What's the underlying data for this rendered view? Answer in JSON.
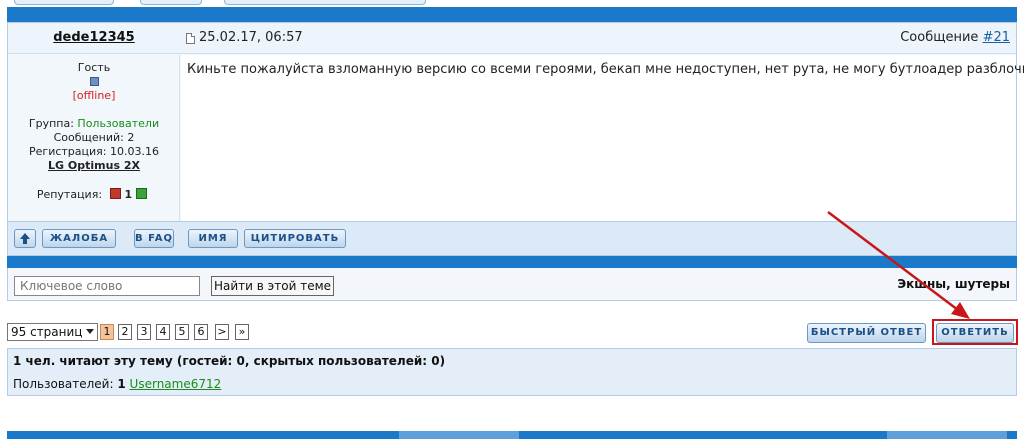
{
  "post": {
    "author": "dede12345",
    "date": "25.02.17, 06:57",
    "number_label": "Сообщение",
    "number_link": "#21",
    "text": "Киньте пожалуйста взломанную версию со всеми героями, бекап мне недоступен, нет рута, не могу бутлоадер разблочить"
  },
  "author_info": {
    "role": "Гость",
    "status": "[offline]",
    "group_label": "Группа:",
    "group_value": "Пользователи",
    "messages": "Сообщений: 2",
    "registration": "Регистрация: 10.03.16",
    "device": "LG Optimus 2X",
    "reputation_label": "Репутация:",
    "reputation_value": "1"
  },
  "actions": {
    "complaint": "ЖАЛОБА",
    "faq": "В FAQ",
    "name": "ИМЯ",
    "quote": "ЦИТИРОВАТЬ"
  },
  "search": {
    "placeholder": "Ключевое слово",
    "button": "Найти в этой теме",
    "category": "Экшны, шутеры"
  },
  "pagination": {
    "pages_label": "95 страниц",
    "pages": [
      "1",
      "2",
      "3",
      "4",
      "5",
      "6"
    ],
    "current": "1",
    "next": ">",
    "last": "»"
  },
  "reply": {
    "quick": "БЫСТРЫЙ ОТВЕТ",
    "reply": "ОТВЕТИТЬ"
  },
  "readers": {
    "title": "1 чел. читают эту тему (гостей: 0, скрытых пользователей: 0)",
    "users_label": "Пользователей:",
    "users_count": "1",
    "user": "Username6712"
  },
  "colors": {
    "bar_blue": "#1a79c9",
    "annotation_red": "#c8171b",
    "offline_red": "#d42020",
    "group_green": "#1a8c1a"
  }
}
